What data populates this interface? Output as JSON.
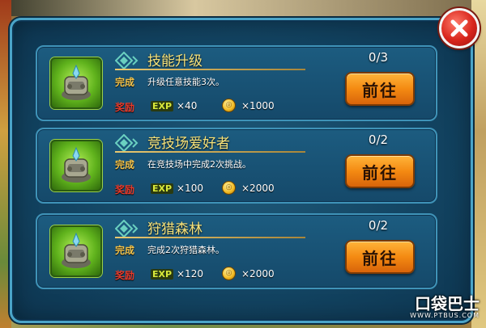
{
  "dialog": {
    "close_label": "×"
  },
  "tasks": [
    {
      "title": "技能升级",
      "done_label": "完成",
      "description": "升级任意技能3次。",
      "reward_label": "奖励",
      "exp_label": "EXP",
      "exp_value": "×40",
      "gold_value": "×1000",
      "progress": "0/3",
      "go_label": "前往"
    },
    {
      "title": "竞技场爱好者",
      "done_label": "完成",
      "description": "在竞技场中完成2次挑战。",
      "reward_label": "奖励",
      "exp_label": "EXP",
      "exp_value": "×100",
      "gold_value": "×2000",
      "progress": "0/2",
      "go_label": "前往"
    },
    {
      "title": "狩猎森林",
      "done_label": "完成",
      "description": "完成2次狩猎森林。",
      "reward_label": "奖励",
      "exp_label": "EXP",
      "exp_value": "×120",
      "gold_value": "×2000",
      "progress": "0/2",
      "go_label": "前往"
    }
  ],
  "watermark": {
    "main": "口袋巴士",
    "sub": "WWW.PTBUS.COM"
  },
  "colors": {
    "panel_bg": "#134563",
    "panel_border": "#4aa4c8",
    "title_text": "#f6e27a",
    "button_orange": "#f48a12",
    "close_red": "#d8261c"
  }
}
